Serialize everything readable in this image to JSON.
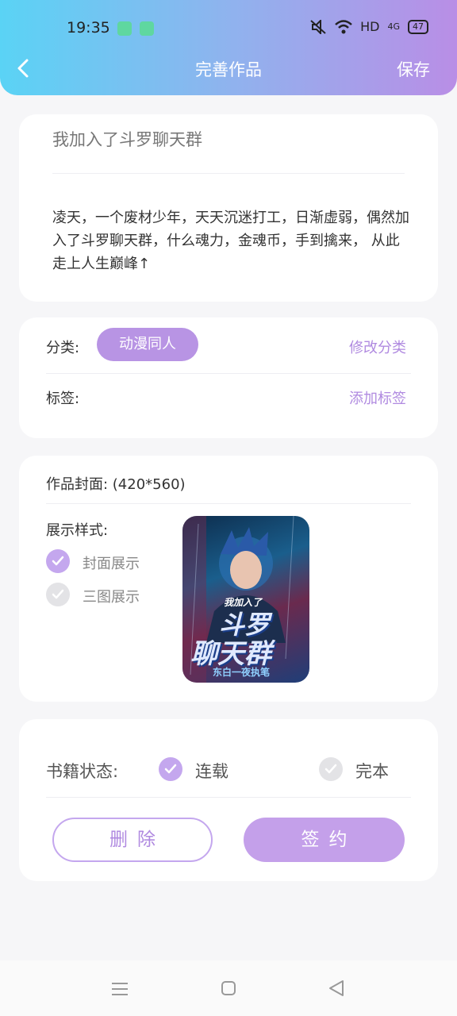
{
  "status_bar": {
    "time": "19:35",
    "network": "HD",
    "signal": "4G",
    "battery": "47"
  },
  "header": {
    "title": "完善作品",
    "save_label": "保存"
  },
  "work": {
    "title": "我加入了斗罗聊天群",
    "description": "凌天，一个废材少年，天天沉迷打工，日渐虚弱，偶然加入了斗罗聊天群，什么魂力，金魂币，手到擒来， 从此走上人生巅峰↑"
  },
  "classification": {
    "category_label": "分类:",
    "category_value": "动漫同人",
    "edit_category": "修改分类",
    "tags_label": "标签:",
    "add_tag": "添加标签"
  },
  "cover": {
    "label": "作品封面: (420*560)",
    "style_label": "展示样式:",
    "options": [
      {
        "label": "封面展示",
        "selected": true
      },
      {
        "label": "三图展示",
        "selected": false
      }
    ],
    "image_text": {
      "top": "我加入了",
      "line1": "斗罗",
      "line2": "聊天群",
      "author": "东白一夜执笔"
    }
  },
  "book_status": {
    "label": "书籍状态:",
    "options": [
      {
        "label": "连载",
        "selected": true
      },
      {
        "label": "完本",
        "selected": false
      }
    ]
  },
  "actions": {
    "delete_label": "删除",
    "sign_label": "签约"
  },
  "colors": {
    "accent": "#b894e4",
    "link": "#b08ae0",
    "header_start": "#5ad3f5",
    "header_end": "#b98ee6"
  }
}
